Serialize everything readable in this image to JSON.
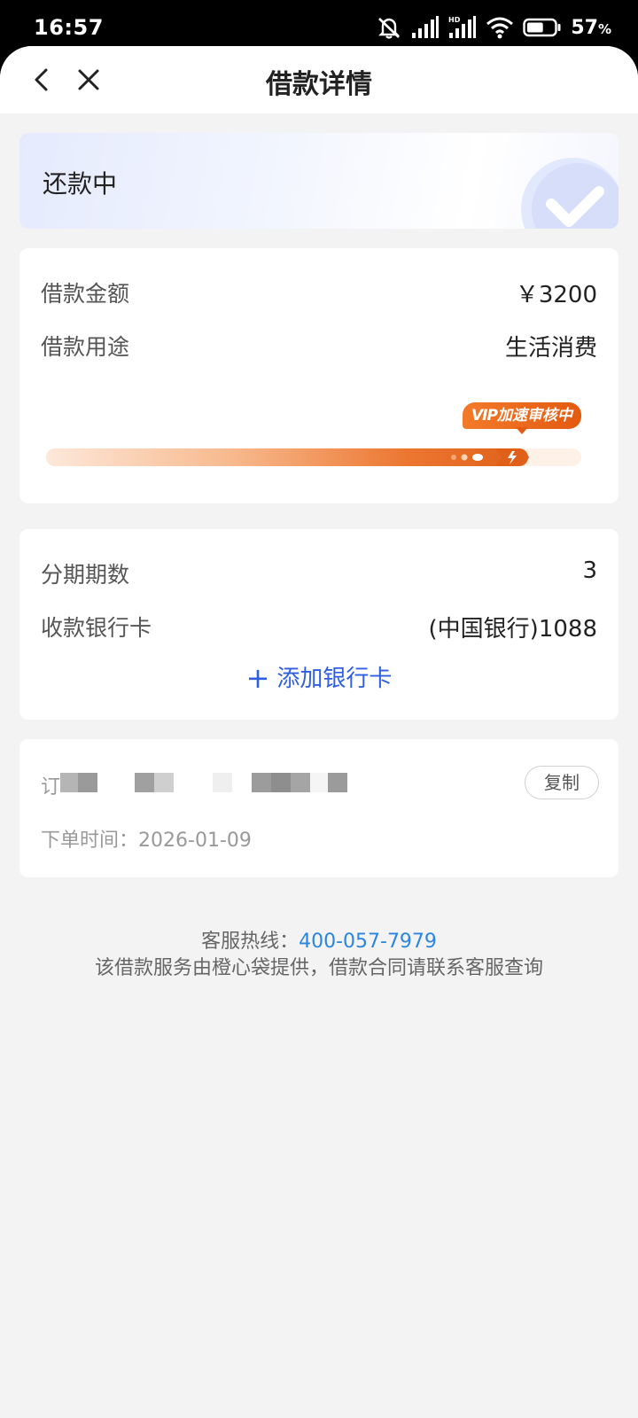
{
  "status_bar": {
    "time": "16:57",
    "battery_percent": "57",
    "battery_unit": "%",
    "battery_level": 0.57,
    "icons": [
      "mute-icon",
      "signal-icon",
      "hd-signal-icon",
      "wifi-icon",
      "battery-icon"
    ]
  },
  "nav": {
    "title": "借款详情",
    "back_icon": "chevron-left-icon",
    "close_icon": "close-icon"
  },
  "status": {
    "label": "还款中",
    "icon": "check-circle-icon"
  },
  "loan": {
    "amount_label": "借款金额",
    "amount_value": "￥3200",
    "purpose_label": "借款用途",
    "purpose_value": "生活消费",
    "vip_prefix": "VIP",
    "vip_text": "加速审核中",
    "progress": 0.9,
    "accent_color": "#e8661c"
  },
  "installment": {
    "periods_label": "分期期数",
    "periods_value": "3",
    "bank_label": "收款银行卡",
    "bank_value": "(中国银行)1088",
    "add_card_label": "添加银行卡",
    "link_color": "#2f5fe0"
  },
  "order": {
    "number_label": "订",
    "copy_label": "复制",
    "time_label": "下单时间：",
    "time_value": "2026-01-09"
  },
  "footer": {
    "hotline_label": "客服热线：",
    "hotline_number": "400-057-7979",
    "note": "该借款服务由橙心袋提供，借款合同请联系客服查询"
  }
}
